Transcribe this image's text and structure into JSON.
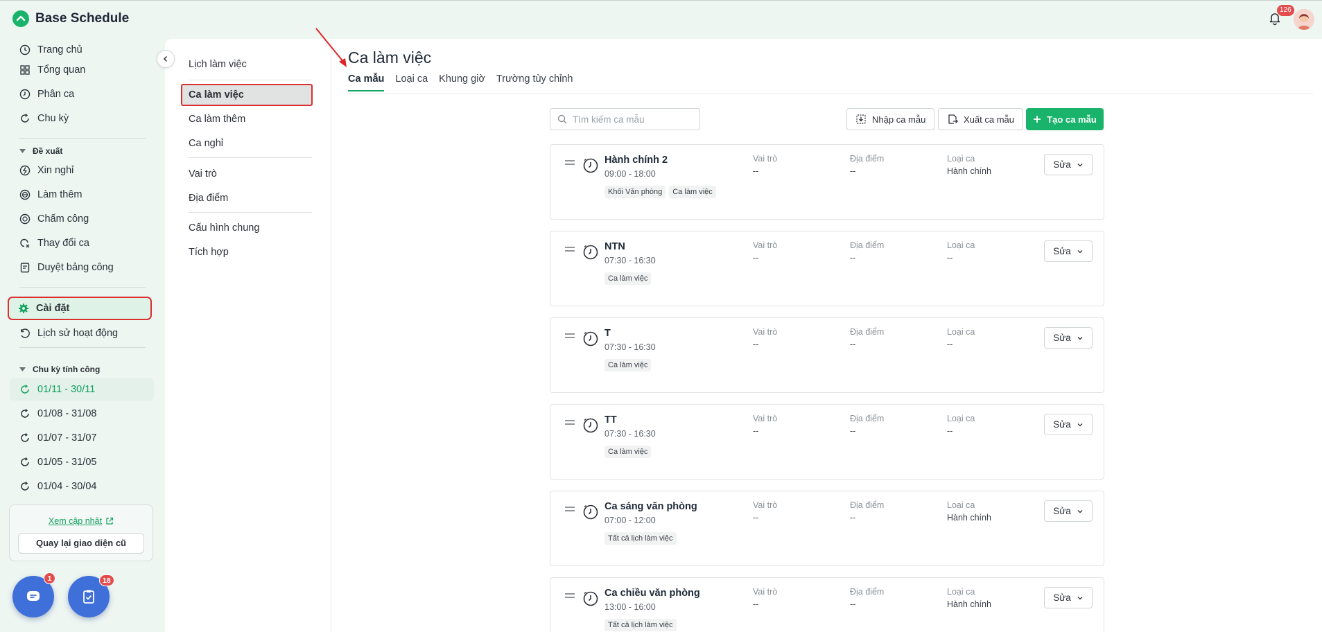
{
  "app": {
    "title": "Base Schedule"
  },
  "header": {
    "notification_count": "126"
  },
  "sidebar": {
    "items": [
      {
        "label": "Trang chủ",
        "icon": "home-icon"
      },
      {
        "label": "Tổng quan",
        "icon": "grid-icon"
      },
      {
        "label": "Phân ca",
        "icon": "clock-icon"
      },
      {
        "label": "Chu kỳ",
        "icon": "cycle-icon"
      }
    ],
    "proposal_group": "Đề xuất",
    "proposal_items": [
      {
        "label": "Xin nghỉ",
        "icon": "leave-icon"
      },
      {
        "label": "Làm thêm",
        "icon": "overtime-icon"
      },
      {
        "label": "Chấm công",
        "icon": "timekeeping-icon"
      },
      {
        "label": "Thay đổi ca",
        "icon": "swap-icon"
      },
      {
        "label": "Duyệt bảng công",
        "icon": "approve-icon"
      }
    ],
    "settings": "Cài đặt",
    "activity_history": "Lịch sử hoạt động",
    "cycle_group": "Chu kỳ tính công",
    "cycles": [
      "01/11 - 30/11",
      "01/08 - 31/08",
      "01/07 - 31/07",
      "01/05 - 31/05",
      "01/04 - 30/04"
    ],
    "update_link": "Xem cập nhật",
    "old_ui_button": "Quay lại giao diện cũ",
    "chat_badge": "1",
    "tasks_badge": "18"
  },
  "settings_nav": {
    "items": [
      "Lịch làm việc",
      "Ca làm việc",
      "Ca làm thêm",
      "Ca nghỉ",
      "Vai trò",
      "Địa điểm",
      "Cấu hình chung",
      "Tích hợp"
    ]
  },
  "main": {
    "title": "Ca làm việc",
    "tabs": [
      "Ca mẫu",
      "Loại ca",
      "Khung giờ",
      "Trường tùy chỉnh"
    ],
    "search_placeholder": "Tìm kiếm ca mẫu",
    "import_button": "Nhập ca mẫu",
    "export_button": "Xuất ca mẫu",
    "create_button": "Tạo ca mẫu",
    "col_role": "Vai trò",
    "col_location": "Địa điểm",
    "col_type": "Loại ca",
    "edit_label": "Sửa",
    "shifts": [
      {
        "name": "Hành chính 2",
        "time": "09:00 - 18:00",
        "tags": [
          "Khối Văn phòng",
          "Ca làm việc"
        ],
        "role": "--",
        "location": "--",
        "type": "Hành chính"
      },
      {
        "name": "NTN",
        "time": "07:30 - 16:30",
        "tags": [
          "Ca làm việc"
        ],
        "role": "--",
        "location": "--",
        "type": "--"
      },
      {
        "name": "T",
        "time": "07:30 - 16:30",
        "tags": [
          "Ca làm việc"
        ],
        "role": "--",
        "location": "--",
        "type": "--"
      },
      {
        "name": "TT",
        "time": "07:30 - 16:30",
        "tags": [
          "Ca làm việc"
        ],
        "role": "--",
        "location": "--",
        "type": "--"
      },
      {
        "name": "Ca sáng văn phòng",
        "time": "07:00 - 12:00",
        "tags": [
          "Tất cả lịch làm việc"
        ],
        "role": "--",
        "location": "--",
        "type": "Hành chính"
      },
      {
        "name": "Ca chiều văn phòng",
        "time": "13:00 - 16:00",
        "tags": [
          "Tất cả lịch làm việc"
        ],
        "role": "--",
        "location": "--",
        "type": "Hành chính"
      }
    ]
  },
  "colors": {
    "accent": "#19b36b",
    "highlight": "#d93030",
    "fab": "#3f6fd8"
  }
}
